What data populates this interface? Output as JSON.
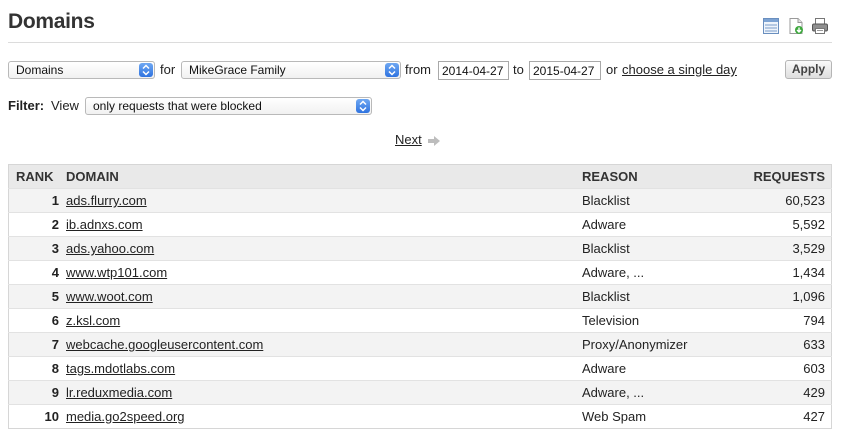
{
  "page": {
    "title": "Domains"
  },
  "toolbar": {
    "icons": [
      "table-view-icon",
      "export-icon",
      "print-icon"
    ]
  },
  "report_controls": {
    "report_type": "Domains",
    "for_label": "for",
    "network": "MikeGrace Family",
    "from_label": "from",
    "from_date": "2014-04-27",
    "to_label": "to",
    "to_date": "2015-04-27",
    "or_label": "or",
    "single_day_link": "choose a single day",
    "apply_label": "Apply"
  },
  "filter": {
    "label": "Filter:",
    "view_label": "View",
    "selected": "only requests that were blocked"
  },
  "pagination": {
    "next_label": "Next"
  },
  "table": {
    "headers": {
      "rank": "RANK",
      "domain": "DOMAIN",
      "reason": "REASON",
      "requests": "REQUESTS"
    },
    "rows": [
      {
        "rank": "1",
        "domain": "ads.flurry.com",
        "reason": "Blacklist",
        "requests": "60,523"
      },
      {
        "rank": "2",
        "domain": "ib.adnxs.com",
        "reason": "Adware",
        "requests": "5,592"
      },
      {
        "rank": "3",
        "domain": "ads.yahoo.com",
        "reason": "Blacklist",
        "requests": "3,529"
      },
      {
        "rank": "4",
        "domain": "www.wtp101.com",
        "reason": "Adware, ...",
        "requests": "1,434"
      },
      {
        "rank": "5",
        "domain": "www.woot.com",
        "reason": "Blacklist",
        "requests": "1,096"
      },
      {
        "rank": "6",
        "domain": "z.ksl.com",
        "reason": "Television",
        "requests": "794"
      },
      {
        "rank": "7",
        "domain": "webcache.googleusercontent.com",
        "reason": "Proxy/Anonymizer",
        "requests": "633"
      },
      {
        "rank": "8",
        "domain": "tags.mdotlabs.com",
        "reason": "Adware",
        "requests": "603"
      },
      {
        "rank": "9",
        "domain": "lr.reduxmedia.com",
        "reason": "Adware, ...",
        "requests": "429"
      },
      {
        "rank": "10",
        "domain": "media.go2speed.org",
        "reason": "Web Spam",
        "requests": "427"
      }
    ]
  }
}
